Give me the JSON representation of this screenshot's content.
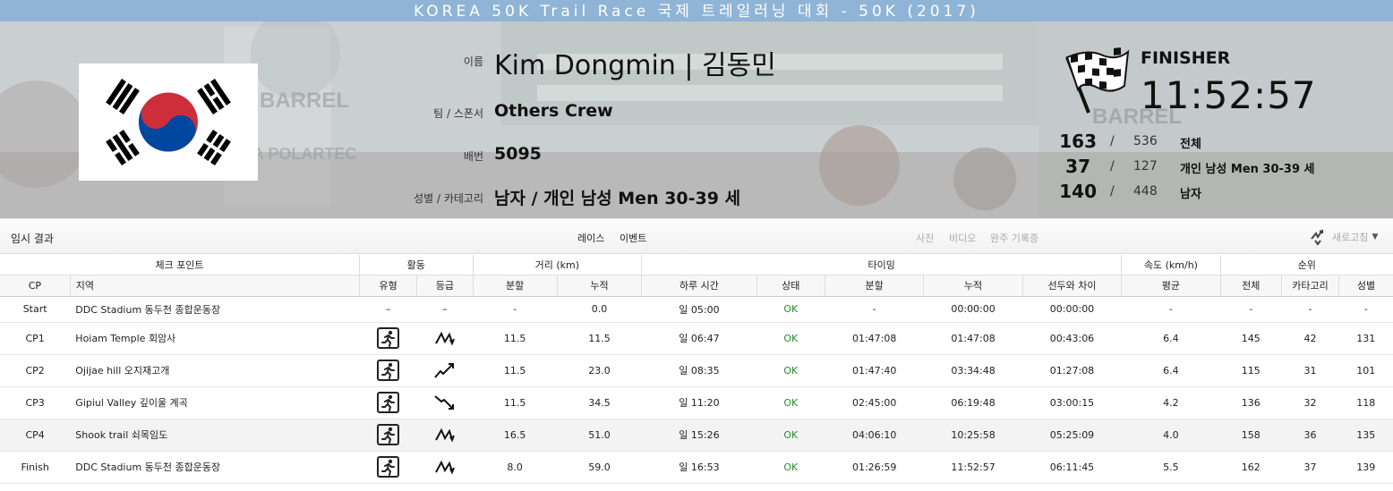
{
  "race": {
    "title": "KOREA 50K Trail Race 국제 트레일러닝 대회 - 50K (2017)"
  },
  "athlete": {
    "name_label": "이름",
    "name": "Kim Dongmin | 김동민",
    "team_label": "팀 / 스폰서",
    "team": "Others Crew",
    "bib_label": "배번",
    "bib": "5095",
    "category_label": "성별 / 카테고리",
    "category": "남자 / 개인 남성 Men 30-39 세",
    "country_flag": "korea-flag-icon"
  },
  "result": {
    "status": "FINISHER",
    "time": "11:52:57",
    "ranks": [
      {
        "rank": "163",
        "total": "536",
        "label": "전체"
      },
      {
        "rank": "37",
        "total": "127",
        "label": "개인 남성 Men 30-39 세"
      },
      {
        "rank": "140",
        "total": "448",
        "label": "남자"
      }
    ]
  },
  "toolbar": {
    "left": "임시 결과",
    "race_tab": "레이스",
    "event_tab": "이벤트",
    "photo": "사진",
    "video": "비디오",
    "certificate": "완주 기록증",
    "refresh": "새로고침"
  },
  "table": {
    "groups": {
      "checkpoint": "체크 포인트",
      "activity": "활동",
      "distance": "거리 (km)",
      "timing": "타이밍",
      "speed": "속도 (km/h)",
      "rank": "순위"
    },
    "columns": {
      "cp": "CP",
      "location": "지역",
      "type": "유형",
      "grade": "등급",
      "split_dist": "분할",
      "cum_dist": "누적",
      "time_of_day": "하루 시간",
      "status": "상태",
      "split_time": "분할",
      "cum_time": "누적",
      "gap": "선두와 차이",
      "avg_speed": "평균",
      "rank_overall": "전체",
      "rank_category": "카타고리",
      "rank_gender": "성별"
    },
    "rows": [
      {
        "cp": "Start",
        "location": "DDC Stadium 동두천 종합운동장",
        "type": "–",
        "grade": "–",
        "split_dist": "-",
        "cum_dist": "0.0",
        "time_of_day": "일 05:00",
        "status": "OK",
        "split_time": "-",
        "cum_time": "00:00:00",
        "gap": "00:00:00",
        "avg_speed": "-",
        "rank_overall": "-",
        "rank_category": "-",
        "rank_gender": "-"
      },
      {
        "cp": "CP1",
        "location": "Hoiam Temple 회암사",
        "type": "run",
        "grade": "up-down",
        "split_dist": "11.5",
        "cum_dist": "11.5",
        "time_of_day": "일 06:47",
        "status": "OK",
        "split_time": "01:47:08",
        "cum_time": "01:47:08",
        "gap": "00:43:06",
        "avg_speed": "6.4",
        "rank_overall": "145",
        "rank_category": "42",
        "rank_gender": "131"
      },
      {
        "cp": "CP2",
        "location": "Ojijae hill 오지재고개",
        "type": "run",
        "grade": "uphill",
        "split_dist": "11.5",
        "cum_dist": "23.0",
        "time_of_day": "일 08:35",
        "status": "OK",
        "split_time": "01:47:40",
        "cum_time": "03:34:48",
        "gap": "01:27:08",
        "avg_speed": "6.4",
        "rank_overall": "115",
        "rank_category": "31",
        "rank_gender": "101"
      },
      {
        "cp": "CP3",
        "location": "Gipiul Valley 깊이울 계곡",
        "type": "run",
        "grade": "downhill",
        "split_dist": "11.5",
        "cum_dist": "34.5",
        "time_of_day": "일 11:20",
        "status": "OK",
        "split_time": "02:45:00",
        "cum_time": "06:19:48",
        "gap": "03:00:15",
        "avg_speed": "4.2",
        "rank_overall": "136",
        "rank_category": "32",
        "rank_gender": "118"
      },
      {
        "cp": "CP4",
        "location": "Shook trail 쇠목임도",
        "type": "run",
        "grade": "up-down",
        "split_dist": "16.5",
        "cum_dist": "51.0",
        "time_of_day": "일 15:26",
        "status": "OK",
        "split_time": "04:06:10",
        "cum_time": "10:25:58",
        "gap": "05:25:09",
        "avg_speed": "4.0",
        "rank_overall": "158",
        "rank_category": "36",
        "rank_gender": "135"
      },
      {
        "cp": "Finish",
        "location": "DDC Stadium 동두천 종합운동장",
        "type": "run",
        "grade": "up-down",
        "split_dist": "8.0",
        "cum_dist": "59.0",
        "time_of_day": "일 16:53",
        "status": "OK",
        "split_time": "01:26:59",
        "cum_time": "11:52:57",
        "gap": "06:11:45",
        "avg_speed": "5.5",
        "rank_overall": "162",
        "rank_category": "37",
        "rank_gender": "139"
      }
    ]
  }
}
